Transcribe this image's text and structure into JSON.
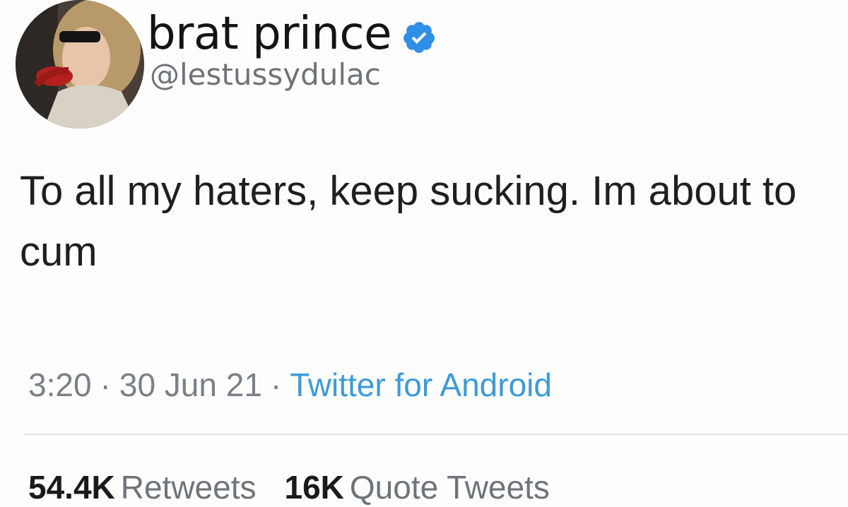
{
  "user": {
    "display_name": "brat prince",
    "handle": "@lestussydulac",
    "verified_icon": "verified-badge-icon",
    "avatar_icon": "avatar-photo"
  },
  "tweet": {
    "text": "To all my haters, keep sucking. Im about to cum",
    "time": "3:20",
    "separator": "·",
    "date": "30 Jun 21",
    "source": "Twitter for Android"
  },
  "stats": {
    "retweets_count": "54.4K",
    "retweets_label": "Retweets",
    "quotes_count": "16K",
    "quotes_label": "Quote Tweets"
  },
  "colors": {
    "verified": "#2f8fe6",
    "source_link": "#3f9ad6",
    "muted_text": "#7a8088"
  }
}
